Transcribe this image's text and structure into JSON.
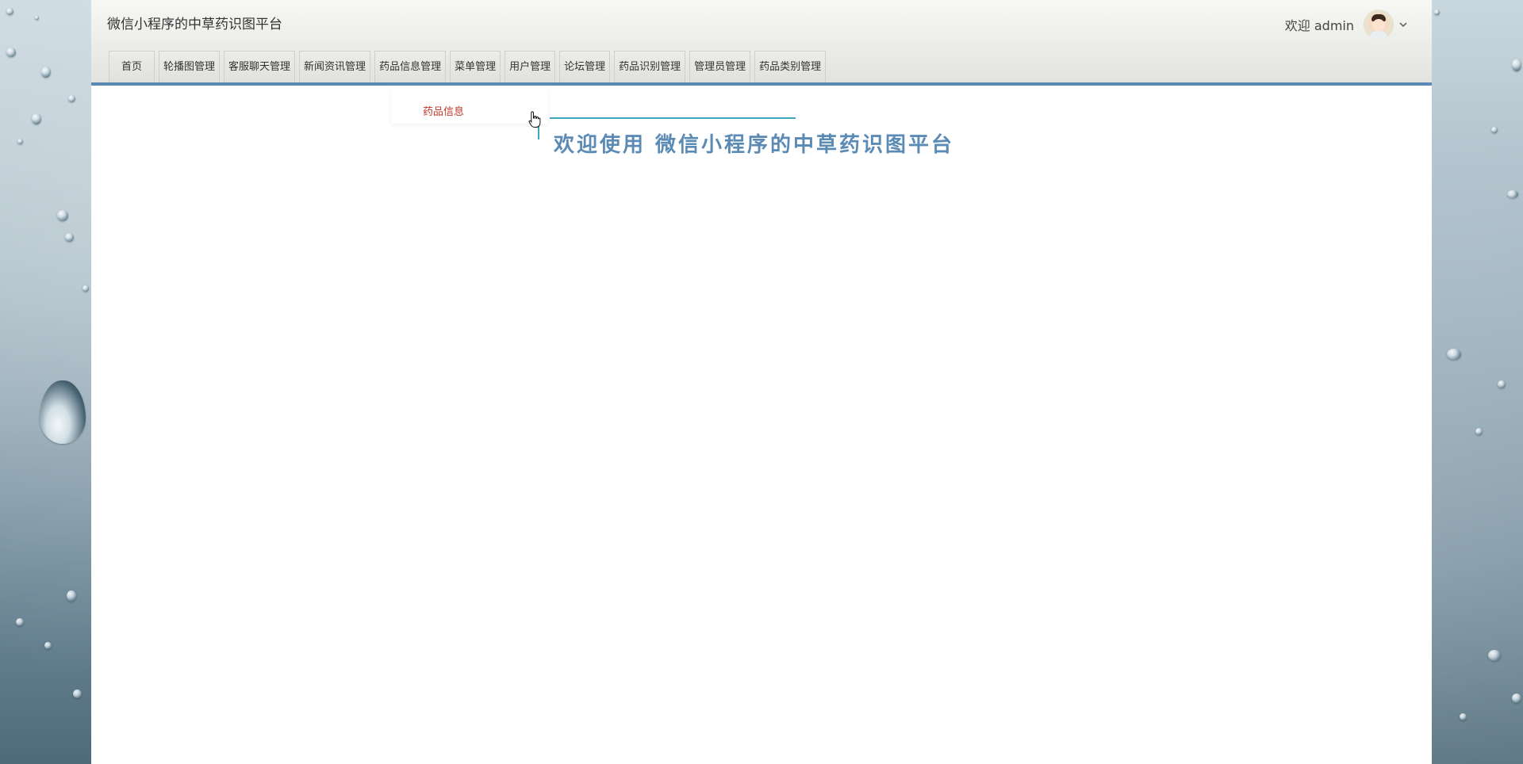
{
  "app": {
    "title": "微信小程序的中草药识图平台"
  },
  "user": {
    "greeting": "欢迎 admin",
    "avatar_icon": "avatar-icon",
    "menu_icon": "chevron-down-icon"
  },
  "nav": {
    "items": [
      {
        "label": "首页"
      },
      {
        "label": "轮播图管理"
      },
      {
        "label": "客服聊天管理"
      },
      {
        "label": "新闻资讯管理"
      },
      {
        "label": "药品信息管理"
      },
      {
        "label": "菜单管理"
      },
      {
        "label": "用户管理"
      },
      {
        "label": "论坛管理"
      },
      {
        "label": "药品识别管理"
      },
      {
        "label": "管理员管理"
      },
      {
        "label": "药品类别管理"
      }
    ],
    "open_dropdown": {
      "items": [
        {
          "label": "药品信息"
        }
      ]
    }
  },
  "main": {
    "welcome": "欢迎使用 微信小程序的中草药识图平台"
  },
  "colors": {
    "accent": "#5b8bb5",
    "teal_line": "#3fa7bd",
    "dropdown_text": "#c0392b"
  }
}
